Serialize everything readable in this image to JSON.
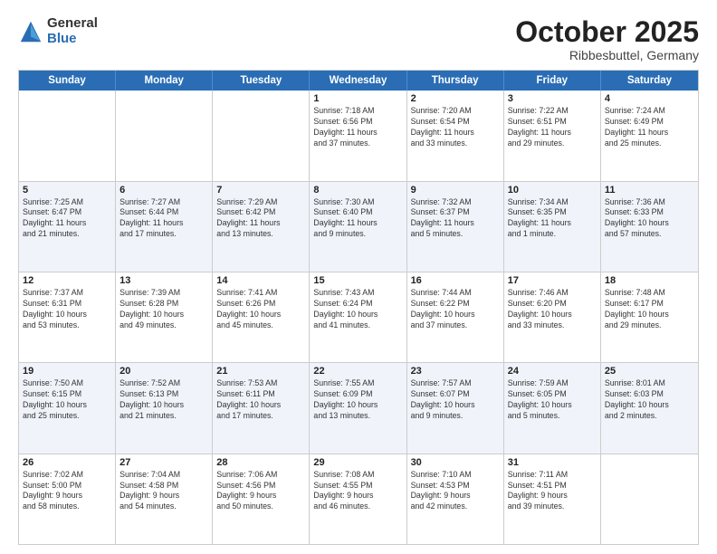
{
  "logo": {
    "general": "General",
    "blue": "Blue"
  },
  "title": "October 2025",
  "subtitle": "Ribbesbuttel, Germany",
  "headers": [
    "Sunday",
    "Monday",
    "Tuesday",
    "Wednesday",
    "Thursday",
    "Friday",
    "Saturday"
  ],
  "weeks": [
    [
      {
        "day": "",
        "info": ""
      },
      {
        "day": "",
        "info": ""
      },
      {
        "day": "",
        "info": ""
      },
      {
        "day": "1",
        "info": "Sunrise: 7:18 AM\nSunset: 6:56 PM\nDaylight: 11 hours\nand 37 minutes."
      },
      {
        "day": "2",
        "info": "Sunrise: 7:20 AM\nSunset: 6:54 PM\nDaylight: 11 hours\nand 33 minutes."
      },
      {
        "day": "3",
        "info": "Sunrise: 7:22 AM\nSunset: 6:51 PM\nDaylight: 11 hours\nand 29 minutes."
      },
      {
        "day": "4",
        "info": "Sunrise: 7:24 AM\nSunset: 6:49 PM\nDaylight: 11 hours\nand 25 minutes."
      }
    ],
    [
      {
        "day": "5",
        "info": "Sunrise: 7:25 AM\nSunset: 6:47 PM\nDaylight: 11 hours\nand 21 minutes."
      },
      {
        "day": "6",
        "info": "Sunrise: 7:27 AM\nSunset: 6:44 PM\nDaylight: 11 hours\nand 17 minutes."
      },
      {
        "day": "7",
        "info": "Sunrise: 7:29 AM\nSunset: 6:42 PM\nDaylight: 11 hours\nand 13 minutes."
      },
      {
        "day": "8",
        "info": "Sunrise: 7:30 AM\nSunset: 6:40 PM\nDaylight: 11 hours\nand 9 minutes."
      },
      {
        "day": "9",
        "info": "Sunrise: 7:32 AM\nSunset: 6:37 PM\nDaylight: 11 hours\nand 5 minutes."
      },
      {
        "day": "10",
        "info": "Sunrise: 7:34 AM\nSunset: 6:35 PM\nDaylight: 11 hours\nand 1 minute."
      },
      {
        "day": "11",
        "info": "Sunrise: 7:36 AM\nSunset: 6:33 PM\nDaylight: 10 hours\nand 57 minutes."
      }
    ],
    [
      {
        "day": "12",
        "info": "Sunrise: 7:37 AM\nSunset: 6:31 PM\nDaylight: 10 hours\nand 53 minutes."
      },
      {
        "day": "13",
        "info": "Sunrise: 7:39 AM\nSunset: 6:28 PM\nDaylight: 10 hours\nand 49 minutes."
      },
      {
        "day": "14",
        "info": "Sunrise: 7:41 AM\nSunset: 6:26 PM\nDaylight: 10 hours\nand 45 minutes."
      },
      {
        "day": "15",
        "info": "Sunrise: 7:43 AM\nSunset: 6:24 PM\nDaylight: 10 hours\nand 41 minutes."
      },
      {
        "day": "16",
        "info": "Sunrise: 7:44 AM\nSunset: 6:22 PM\nDaylight: 10 hours\nand 37 minutes."
      },
      {
        "day": "17",
        "info": "Sunrise: 7:46 AM\nSunset: 6:20 PM\nDaylight: 10 hours\nand 33 minutes."
      },
      {
        "day": "18",
        "info": "Sunrise: 7:48 AM\nSunset: 6:17 PM\nDaylight: 10 hours\nand 29 minutes."
      }
    ],
    [
      {
        "day": "19",
        "info": "Sunrise: 7:50 AM\nSunset: 6:15 PM\nDaylight: 10 hours\nand 25 minutes."
      },
      {
        "day": "20",
        "info": "Sunrise: 7:52 AM\nSunset: 6:13 PM\nDaylight: 10 hours\nand 21 minutes."
      },
      {
        "day": "21",
        "info": "Sunrise: 7:53 AM\nSunset: 6:11 PM\nDaylight: 10 hours\nand 17 minutes."
      },
      {
        "day": "22",
        "info": "Sunrise: 7:55 AM\nSunset: 6:09 PM\nDaylight: 10 hours\nand 13 minutes."
      },
      {
        "day": "23",
        "info": "Sunrise: 7:57 AM\nSunset: 6:07 PM\nDaylight: 10 hours\nand 9 minutes."
      },
      {
        "day": "24",
        "info": "Sunrise: 7:59 AM\nSunset: 6:05 PM\nDaylight: 10 hours\nand 5 minutes."
      },
      {
        "day": "25",
        "info": "Sunrise: 8:01 AM\nSunset: 6:03 PM\nDaylight: 10 hours\nand 2 minutes."
      }
    ],
    [
      {
        "day": "26",
        "info": "Sunrise: 7:02 AM\nSunset: 5:00 PM\nDaylight: 9 hours\nand 58 minutes."
      },
      {
        "day": "27",
        "info": "Sunrise: 7:04 AM\nSunset: 4:58 PM\nDaylight: 9 hours\nand 54 minutes."
      },
      {
        "day": "28",
        "info": "Sunrise: 7:06 AM\nSunset: 4:56 PM\nDaylight: 9 hours\nand 50 minutes."
      },
      {
        "day": "29",
        "info": "Sunrise: 7:08 AM\nSunset: 4:55 PM\nDaylight: 9 hours\nand 46 minutes."
      },
      {
        "day": "30",
        "info": "Sunrise: 7:10 AM\nSunset: 4:53 PM\nDaylight: 9 hours\nand 42 minutes."
      },
      {
        "day": "31",
        "info": "Sunrise: 7:11 AM\nSunset: 4:51 PM\nDaylight: 9 hours\nand 39 minutes."
      },
      {
        "day": "",
        "info": ""
      }
    ]
  ]
}
